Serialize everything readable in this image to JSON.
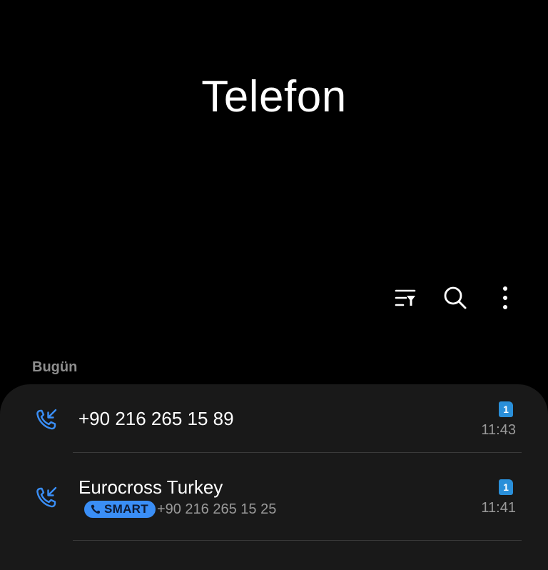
{
  "header": {
    "title": "Telefon"
  },
  "toolbar": {
    "filter_icon": "filter-list-icon",
    "search_icon": "search-icon",
    "more_icon": "more-vertical-icon"
  },
  "section": {
    "label": "Bugün"
  },
  "calls": [
    {
      "type_icon": "incoming-call-icon",
      "primary": "+90 216 265 15 89",
      "sim": "1",
      "time": "11:43"
    },
    {
      "type_icon": "incoming-call-icon",
      "primary": "Eurocross Turkey",
      "badge": "SMART",
      "secondary_number": "+90 216 265 15 25",
      "sim": "1",
      "time": "11:41"
    }
  ],
  "colors": {
    "accent": "#3a8ef6",
    "card_bg": "#191919",
    "sim": "#2a8fd9"
  }
}
